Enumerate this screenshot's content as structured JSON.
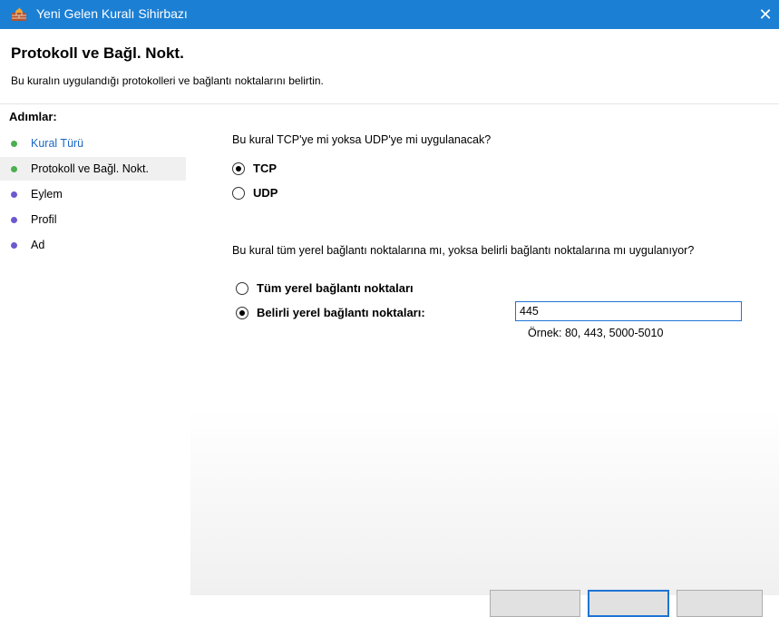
{
  "window": {
    "title": "Yeni Gelen Kuralı Sihirbazı",
    "close_glyph": "✕"
  },
  "header": {
    "title": "Protokoll ve Bağl. Nokt.",
    "description": "Bu kuralın uygulandığı protokolleri ve bağlantı noktalarını belirtin."
  },
  "sidebar": {
    "title": "Adımlar:",
    "steps": [
      {
        "label": "Kural Türü",
        "bullet_color": "#4caf50",
        "state": "completed"
      },
      {
        "label": "Protokoll ve Bağl. Nokt.",
        "bullet_color": "#4caf50",
        "state": "current"
      },
      {
        "label": "Eylem",
        "bullet_color": "#6a5acd",
        "state": "pending"
      },
      {
        "label": "Profil",
        "bullet_color": "#6a5acd",
        "state": "pending"
      },
      {
        "label": "Ad",
        "bullet_color": "#6a5acd",
        "state": "pending"
      }
    ]
  },
  "main": {
    "protocol_question": "Bu kural TCP'ye mi yoksa UDP'ye mi uygulanacak?",
    "protocol_options": [
      {
        "label": "TCP",
        "selected": true
      },
      {
        "label": "UDP",
        "selected": false
      }
    ],
    "port_question": "Bu kural tüm yerel bağlantı noktalarına mı, yoksa belirli bağlantı noktalarına mı uygulanıyor?",
    "port_options": [
      {
        "label": "Tüm yerel bağlantı noktaları",
        "selected": false
      },
      {
        "label": "Belirli yerel bağlantı noktaları:",
        "selected": true
      }
    ],
    "port_value": "445",
    "example": "Örnek: 80, 443, 5000-5010"
  },
  "colors": {
    "titlebar": "#1b7fd4",
    "accent": "#1f74d4",
    "link": "#1a66c6"
  },
  "icons": {
    "app": "firewall-icon",
    "close": "close-icon"
  }
}
